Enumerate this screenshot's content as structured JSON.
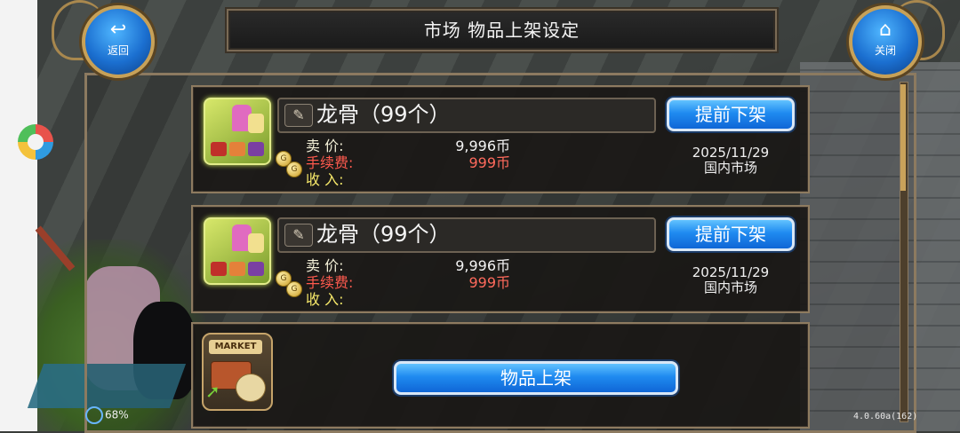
{
  "header": {
    "title": "市场 物品上架设定",
    "back_label": "返回",
    "close_label": "关闭"
  },
  "listings": [
    {
      "name": "龙骨（99个）",
      "price_label": "卖  价:",
      "price": "9,996币",
      "fee_label": "手续费:",
      "fee": "999币",
      "income_label": "收  入:",
      "delist_label": "提前下架",
      "date": "2025/11/29",
      "market": "国内市场"
    },
    {
      "name": "龙骨（99个）",
      "price_label": "卖  价:",
      "price": "9,996币",
      "fee_label": "手续费:",
      "fee": "999币",
      "income_label": "收  入:",
      "delist_label": "提前下架",
      "date": "2025/11/29",
      "market": "国内市场"
    }
  ],
  "new_listing": {
    "market_sign": "MARKET",
    "list_label": "物品上架"
  },
  "status": {
    "battery": "68%",
    "version": "4.0.60a(162)"
  },
  "colors": {
    "accent_blue": "#1f8af0",
    "fee_red": "#ff5a4e",
    "income_yellow": "#f7e96a",
    "frame_gold": "#8c7a60"
  }
}
